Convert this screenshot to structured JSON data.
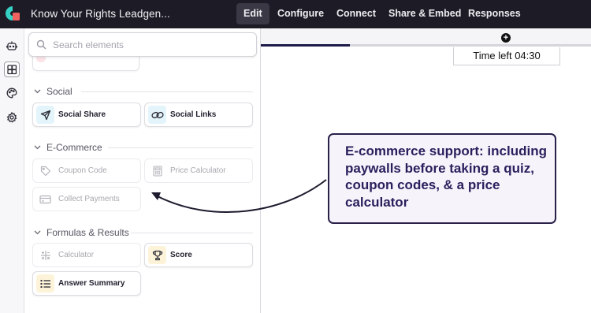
{
  "app": {
    "title": "Know Your Rights Leadgen...",
    "logo": "app-logo"
  },
  "topnav": {
    "items": [
      {
        "label": "Edit",
        "active": true
      },
      {
        "label": "Configure",
        "active": false
      },
      {
        "label": "Connect",
        "active": false
      },
      {
        "label": "Share & Embed",
        "active": false
      },
      {
        "label": "Responses",
        "active": false
      }
    ]
  },
  "rail": {
    "items": [
      {
        "icon": "robot-icon",
        "active": false
      },
      {
        "icon": "elements-icon",
        "active": true
      },
      {
        "icon": "palette-icon",
        "active": false
      },
      {
        "icon": "gear-icon",
        "active": false
      }
    ]
  },
  "panel": {
    "search_placeholder": "Search elements",
    "sections": [
      {
        "title": "Social",
        "items": [
          {
            "label": "Social Share",
            "icon": "send-icon",
            "enabled": true
          },
          {
            "label": "Social Links",
            "icon": "link-icon",
            "enabled": true
          }
        ]
      },
      {
        "title": "E-Commerce",
        "items": [
          {
            "label": "Coupon Code",
            "icon": "tag-icon",
            "enabled": false
          },
          {
            "label": "Price Calculator",
            "icon": "calculator-icon",
            "enabled": false
          },
          {
            "label": "Collect Payments",
            "icon": "credit-card-icon",
            "enabled": false
          }
        ]
      },
      {
        "title": "Formulas & Results",
        "items": [
          {
            "label": "Calculator",
            "icon": "math-icon",
            "enabled": false
          },
          {
            "label": "Score",
            "icon": "trophy-icon",
            "enabled": true
          },
          {
            "label": "Answer Summary",
            "icon": "list-icon",
            "enabled": true
          }
        ]
      }
    ]
  },
  "canvas": {
    "timer": "Time left 04:30",
    "progress_fraction": 0.27
  },
  "callout": {
    "text": "E-commerce support: including paywalls before taking a quiz, coupon codes, & a price calculator"
  },
  "colors": {
    "topbar": "#1d1b25",
    "accent_dark": "#1e1b4b",
    "callout_border": "#2a2048",
    "callout_text": "#2a1f5c",
    "social_icon_bg": "#e3f4fb",
    "score_icon_bg": "#fdf3d8"
  }
}
